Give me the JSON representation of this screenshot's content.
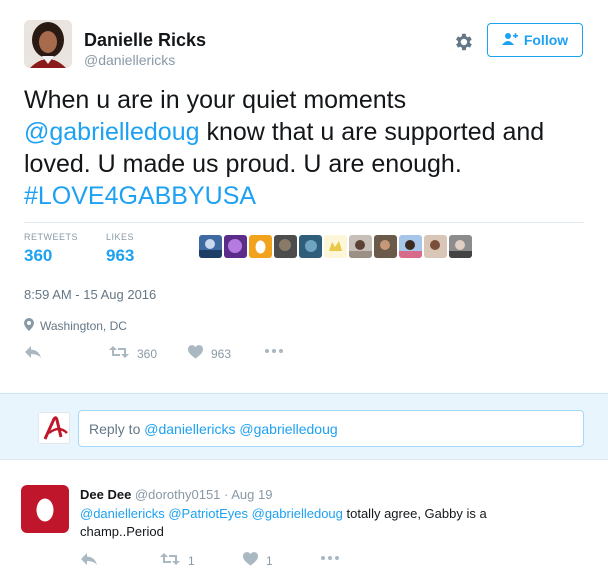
{
  "tweet": {
    "author_name": "Danielle Ricks",
    "author_handle": "@daniellericks",
    "follow_label": "Follow",
    "text_line1": "When u are in your quiet moments",
    "text_mention": "@gabrielledoug",
    "text_line2_rest": " know that u are supported and",
    "text_line3": "loved. U made us proud. U are enough.",
    "hashtag": "#LOVE4GABBYUSA",
    "retweets_label": "RETWEETS",
    "retweets_count": "360",
    "likes_label": "LIKES",
    "likes_count": "963",
    "timestamp": "8:59 AM - 15 Aug 2016",
    "location": "Washington, DC",
    "action_retweet_count": "360",
    "action_like_count": "963"
  },
  "reply_bar": {
    "prefix": "Reply to ",
    "mentions": "@daniellericks @gabrielledoug"
  },
  "reply_tweet": {
    "name": "Dee Dee",
    "handle_date": " @dorothy0151 · Aug 19",
    "mentions": "@daniellericks @PatriotEyes @gabrielledoug",
    "text": "  totally agree, Gabby is a champ..Period",
    "retweet_count": "1",
    "like_count": "1"
  },
  "colors": {
    "accent": "#1da1f2",
    "muted": "#8899a6",
    "reply_bg": "#e8f5fd",
    "egg_red": "#c0162b"
  },
  "icons": [
    "gear-icon",
    "follow-person-plus-icon",
    "location-pin-icon",
    "reply-icon",
    "retweet-icon",
    "like-heart-icon",
    "more-dots-icon"
  ]
}
